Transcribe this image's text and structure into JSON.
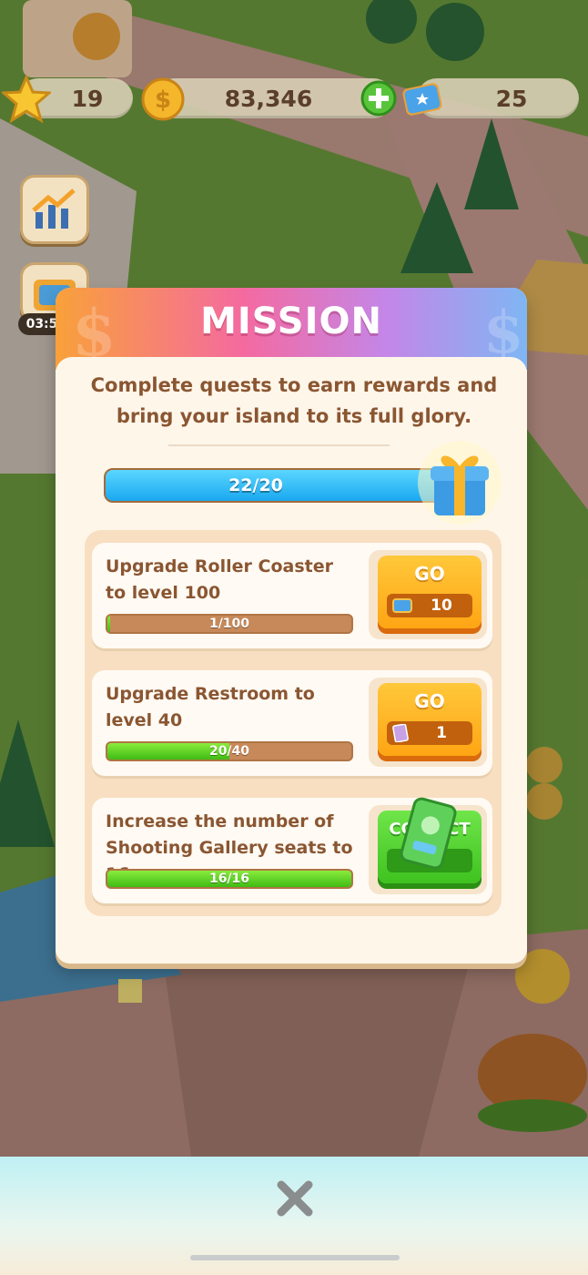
{
  "hud": {
    "stars": "19",
    "cash": "83,346",
    "tickets": "25"
  },
  "side": {
    "timer": "03:5"
  },
  "mission": {
    "title": "MISSION",
    "description": "Complete quests to earn rewards and bring your island to its full glory.",
    "progress_text": "22/20",
    "progress_fraction": 1.0
  },
  "quests": [
    {
      "title": "Upgrade Roller Coaster to level 100",
      "progress_text": "1/100",
      "progress_fraction": 0.01,
      "button_label": "GO",
      "reward_icon": "ticket-stack-icon",
      "reward_amount": "10"
    },
    {
      "title": "Upgrade Restroom to level 40",
      "progress_text": "20/40",
      "progress_fraction": 0.5,
      "button_label": "GO",
      "reward_icon": "card-icon",
      "reward_amount": "1"
    },
    {
      "title": "Increase the number of Shooting Gallery seats to 16",
      "progress_text": "16/16",
      "progress_fraction": 1.0,
      "button_label": "COLLECT",
      "reward_icon": "green-ticket-icon"
    }
  ],
  "colors": {
    "accent_go": "#ffa514",
    "accent_collect": "#3fc21f",
    "progress_blue": "#1aa8f0",
    "text_brown": "#8a5632"
  }
}
